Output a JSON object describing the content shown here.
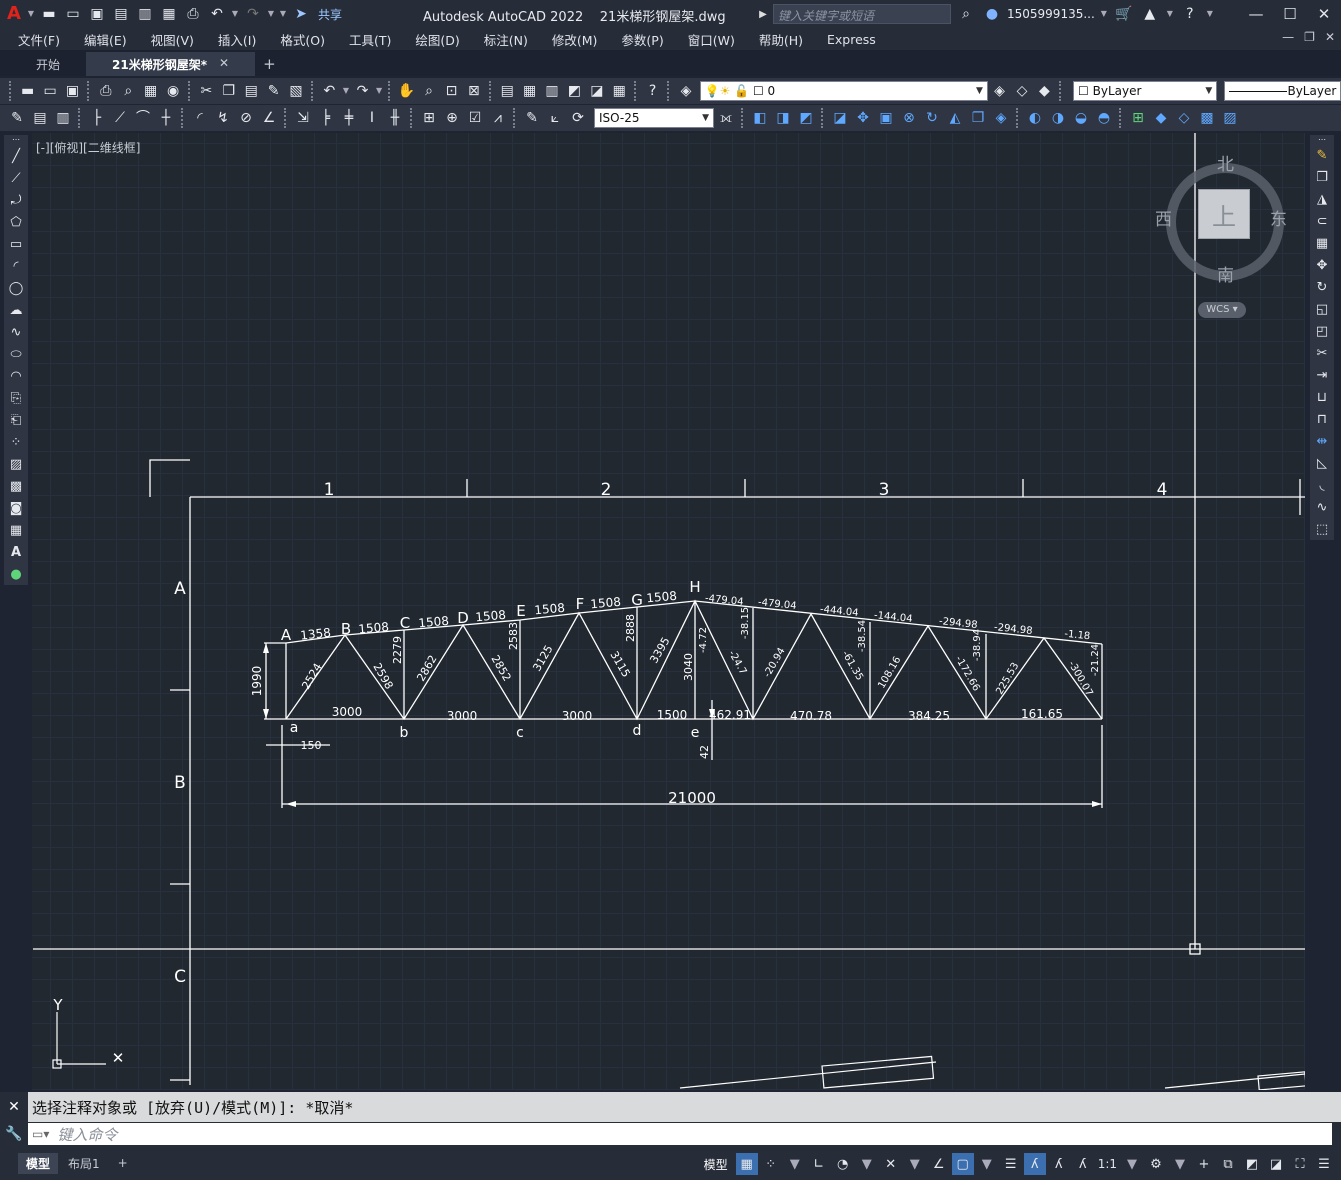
{
  "app": {
    "title": "Autodesk AutoCAD 2022",
    "file": "21米梯形钢屋架.dwg",
    "share": "共享",
    "search_placeholder": "键入关键字或短语",
    "user": "1505999135..."
  },
  "menu": [
    "文件(F)",
    "编辑(E)",
    "视图(V)",
    "插入(I)",
    "格式(O)",
    "工具(T)",
    "绘图(D)",
    "标注(N)",
    "修改(M)",
    "参数(P)",
    "窗口(W)",
    "帮助(H)",
    "Express"
  ],
  "tabs": {
    "start": "开始",
    "active": "21米梯形钢屋架*",
    "close": "✕",
    "add": "+"
  },
  "toolbar": {
    "layer_value": "0",
    "color_value": "ByLayer",
    "linetype_value": "ByLayer",
    "dimstyle_value": "ISO-25"
  },
  "viewport": {
    "label": "[-][俯视][二维线框]"
  },
  "viewcube": {
    "north": "北",
    "south": "南",
    "west": "西",
    "east": "东",
    "face": "上",
    "wcs": "WCS"
  },
  "drawing": {
    "grid_cols": [
      "1",
      "2",
      "3",
      "4"
    ],
    "grid_rows": [
      "A",
      "B",
      "C"
    ],
    "top_nodes": [
      "A",
      "B",
      "C",
      "D",
      "E",
      "F",
      "G",
      "H"
    ],
    "bottom_nodes": [
      "a",
      "b",
      "c",
      "d",
      "e"
    ],
    "top_chord_lengths": [
      "1358",
      "1508",
      "1508",
      "1508",
      "1508",
      "1508",
      "1508"
    ],
    "top_chord_forces": [
      "-479.04",
      "-479.04",
      "-444.04",
      "-144.04",
      "-294.98",
      "-294.98",
      "-1.18"
    ],
    "vertical_lengths": [
      "2279",
      "2583",
      "2888",
      "3040"
    ],
    "diagonal_lengths": [
      "2524",
      "2598",
      "2862",
      "2852",
      "3125",
      "3115",
      "3395"
    ],
    "right_member_forces": [
      "-4.72",
      "-38.15",
      "-24.7",
      "-20.94",
      "-61.35",
      "-38.54",
      "108.16",
      "-172.66",
      "-38.94",
      "225.53",
      "-300.07",
      "-21.24"
    ],
    "bottom_lengths": [
      "3000",
      "3000",
      "3000",
      "1500"
    ],
    "bottom_forces": [
      "462.91",
      "470.78",
      "384.25",
      "161.65"
    ],
    "height": "1990",
    "offset": "150",
    "camber": "42",
    "span": "21000"
  },
  "command": {
    "history": "选择注释对象或 [放弃(U)/模式(M)]: *取消*",
    "placeholder": "键入命令"
  },
  "status": {
    "model_tab": "模型",
    "layout_tab": "布局1",
    "add": "+",
    "model_label": "模型",
    "scale": "1:1"
  }
}
